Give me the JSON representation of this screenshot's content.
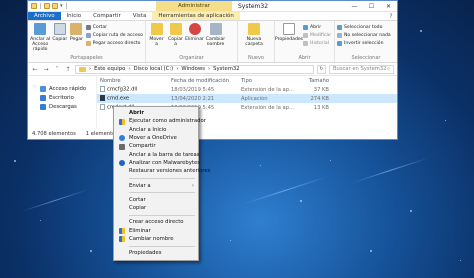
{
  "titlebar": {
    "context_tab": "Administrar",
    "title": "System32",
    "minimize": "—",
    "maximize": "☐",
    "close": "✕"
  },
  "tabs": [
    {
      "label": "Archivo"
    },
    {
      "label": "Inicio"
    },
    {
      "label": "Compartir"
    },
    {
      "label": "Vista"
    },
    {
      "label": "Herramientas de aplicación"
    }
  ],
  "ribbon": {
    "pin_label": "Anclar al Acceso rápido",
    "copy_label": "Copiar",
    "paste_label": "Pegar",
    "cut_label": "Cortar",
    "copy_path_label": "Copiar ruta de acceso",
    "paste_shortcut_label": "Pegar acceso directo",
    "clipboard_group": "Portapapeles",
    "move_label": "Mover a",
    "copy_to_label": "Copiar a",
    "delete_label": "Eliminar",
    "rename_label": "Cambiar nombre",
    "organize_group": "Organizar",
    "new_folder_label": "Nueva carpeta",
    "new_group": "Nuevo",
    "properties_label": "Propiedades",
    "open_label": "Abrir",
    "modify_label": "Modificar",
    "history_label": "Historial",
    "open_group": "Abrir",
    "select_all_label": "Seleccionar todo",
    "select_none_label": "No seleccionar nada",
    "invert_label": "Invertir selección",
    "select_group": "Seleccionar"
  },
  "address": {
    "path": [
      "Este equipo",
      "Disco local (C:)",
      "Windows",
      "System32"
    ],
    "search_placeholder": "Buscar en System32"
  },
  "nav": {
    "items": [
      {
        "label": "Acceso rápido"
      },
      {
        "label": "Escritorio"
      },
      {
        "label": "Descargas"
      }
    ]
  },
  "files": {
    "headers": {
      "name": "Nombre",
      "date": "Fecha de modificación",
      "type": "Tipo",
      "size": "Tamaño"
    },
    "rows": [
      {
        "name": "cmcfg32.dll",
        "date": "18/03/2019 5:45",
        "type": "Extensión de la ap...",
        "size": "37 KB"
      },
      {
        "name": "cmd.exe",
        "date": "13/04/2020 2:21",
        "type": "Aplicación",
        "size": "274 KB"
      },
      {
        "name": "cmdext.dll",
        "date": "18/03/2019 5:45",
        "type": "Extensión de la ap...",
        "size": "13 KB"
      }
    ]
  },
  "status": {
    "count": "4.708 elementos",
    "selected": "1 elemento sele"
  },
  "context_menu": {
    "items": [
      {
        "label": "Abrir"
      },
      {
        "label": "Ejecutar como administrador"
      },
      {
        "label": "Anclar a Inicio"
      },
      {
        "label": "Mover a OneDrive"
      },
      {
        "label": "Compartir"
      },
      {
        "label": "Anclar a la barra de tareas"
      },
      {
        "label": "Analizar con Malwarebytes"
      },
      {
        "label": "Restaurar versiones anteriores"
      },
      {
        "label": "Enviar a"
      },
      {
        "label": "Cortar"
      },
      {
        "label": "Copiar"
      },
      {
        "label": "Crear acceso directo"
      },
      {
        "label": "Eliminar"
      },
      {
        "label": "Cambiar nombre"
      },
      {
        "label": "Propiedades"
      }
    ]
  },
  "colors": {
    "accent": "#1a6fc9",
    "context_tab": "#f5dd8a",
    "selection": "#cce8ff",
    "desktop": "#16539a"
  }
}
